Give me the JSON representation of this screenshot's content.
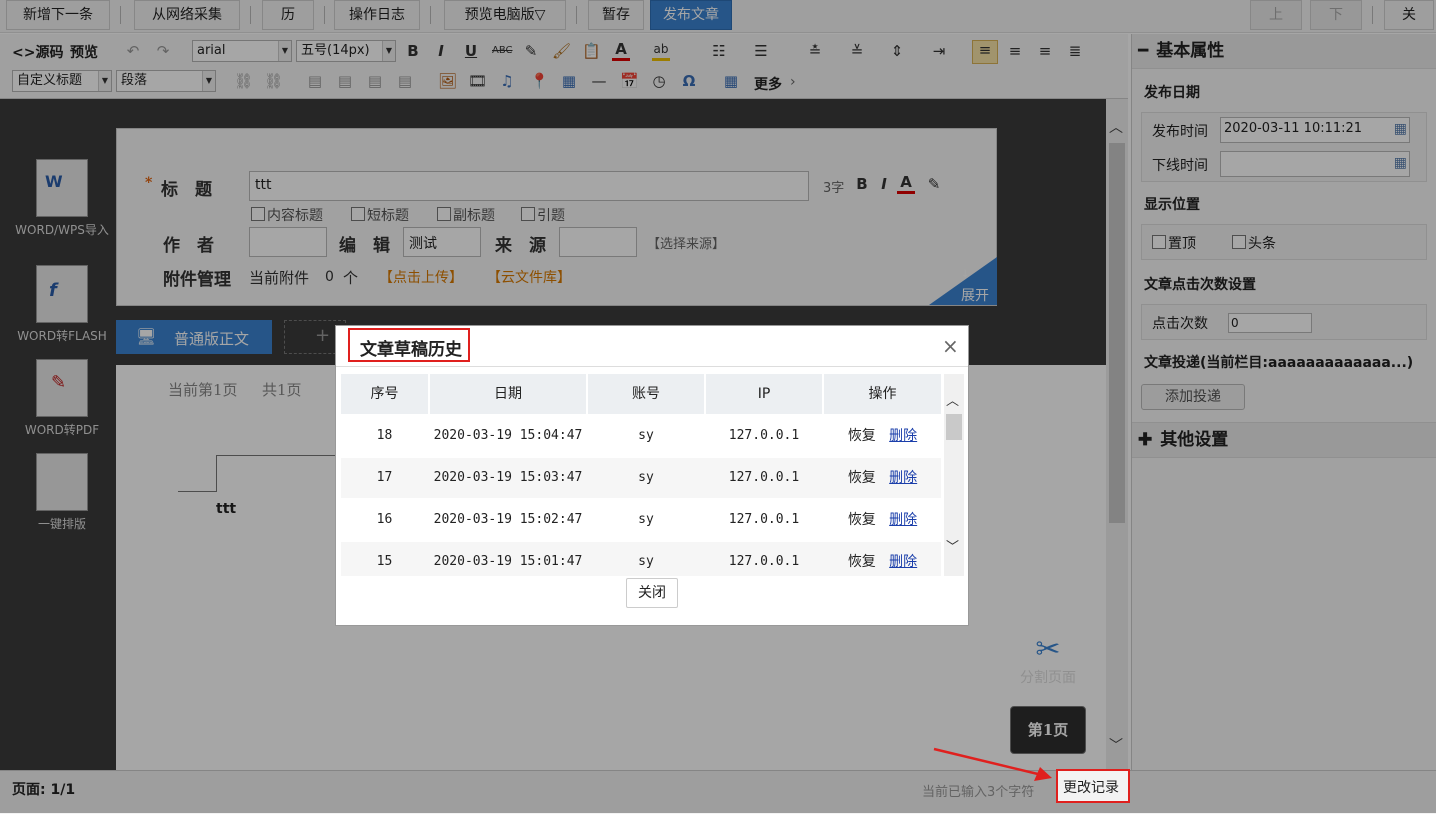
{
  "topbar": {
    "add_next": "新增下一条",
    "web_collect": "从网络采集",
    "history": "历史",
    "op_log": "操作日志",
    "preview_pc": "预览电脑版▽",
    "save_draft": "暂存",
    "publish": "发布文章",
    "prev": "上条",
    "next": "下条",
    "close": "关闭"
  },
  "editor_toolbar": {
    "source": "<>源码",
    "preview": "预览",
    "font_family": "arial",
    "font_size": "五号(14px)",
    "custom_title": "自定义标题",
    "paragraph": "段落",
    "more": "更多",
    "split_page": "分割页面",
    "page_label": "第1页"
  },
  "left_tools": [
    {
      "label": "WORD/WPS导入"
    },
    {
      "label": "WORD转FLASH"
    },
    {
      "label": "WORD转PDF"
    },
    {
      "label": "一键排版"
    }
  ],
  "form": {
    "title_label": "标　题",
    "title_value": "ttt",
    "char_count": "3字",
    "checkboxes": [
      "内容标题",
      "短标题",
      "副标题",
      "引题"
    ],
    "author_label": "作　者",
    "editor_label": "编　辑",
    "editor_value": "测试",
    "source_label": "来　源",
    "choose_source": "【选择来源】",
    "attach_label": "附件管理",
    "attach_current": "当前附件",
    "attach_count": "0",
    "attach_unit": "个",
    "upload": "【点击上传】",
    "cloud": "【云文件库】",
    "expand": "展开"
  },
  "content": {
    "tab_normal": "普通版正文",
    "page_info_current": "当前第1页",
    "page_info_total": "共1页",
    "body_text": "ttt"
  },
  "right_panel": {
    "basic_title": "基本属性",
    "publish_date": "发布日期",
    "publish_time_label": "发布时间",
    "publish_time_value": "2020-03-11 10:11:21",
    "offline_time_label": "下线时间",
    "offline_time_value": "",
    "display_pos": "显示位置",
    "pin_top": "置顶",
    "headline": "头条",
    "click_setting": "文章点击次数设置",
    "click_label": "点击次数",
    "click_value": "0",
    "deliver": "文章投递(当前栏目:aaaaaaaaaaaaa...)",
    "add_deliver": "添加投递",
    "other_settings": "其他设置"
  },
  "status_bar": {
    "page": "页面: 1/1",
    "input_count": "当前已输入3个字符",
    "change_log": "更改记录"
  },
  "modal": {
    "title": "文章草稿历史",
    "headers": [
      "序号",
      "日期",
      "账号",
      "IP",
      "操作"
    ],
    "rows": [
      {
        "no": "18",
        "date": "2020-03-19 15:04:47",
        "account": "sy",
        "ip": "127.0.0.1",
        "restore": "恢复",
        "delete": "删除"
      },
      {
        "no": "17",
        "date": "2020-03-19 15:03:47",
        "account": "sy",
        "ip": "127.0.0.1",
        "restore": "恢复",
        "delete": "删除"
      },
      {
        "no": "16",
        "date": "2020-03-19 15:02:47",
        "account": "sy",
        "ip": "127.0.0.1",
        "restore": "恢复",
        "delete": "删除"
      },
      {
        "no": "15",
        "date": "2020-03-19 15:01:47",
        "account": "sy",
        "ip": "127.0.0.1",
        "restore": "恢复",
        "delete": "删除"
      }
    ],
    "close_button": "关闭"
  },
  "colors": {
    "primary": "#3b83d1",
    "highlight_red": "#e0201e",
    "orange": "#d97a00"
  }
}
